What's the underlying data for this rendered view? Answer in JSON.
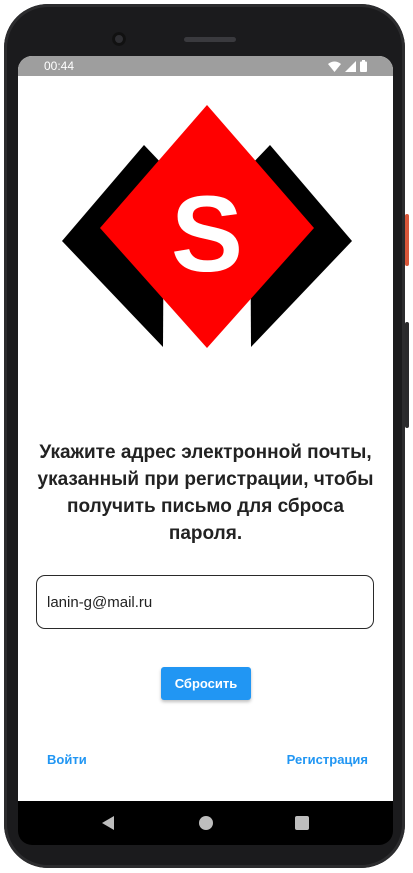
{
  "status_bar": {
    "time": "00:44",
    "icons": [
      "wifi-icon",
      "signal-icon",
      "battery-icon"
    ]
  },
  "logo": {
    "letter": "S",
    "colors": {
      "diamond": "#ff0000",
      "shadow": "#000000",
      "letter": "#ffffff"
    }
  },
  "instruction": "Укажите адрес электронной почты, указанный при регистрации, чтобы получить письмо для сброса пароля.",
  "email": {
    "value": "lanin-g@mail.ru",
    "placeholder": ""
  },
  "reset_button": {
    "label": "Сбросить"
  },
  "links": {
    "login": "Войти",
    "register": "Регистрация"
  },
  "nav_bar": {
    "buttons": [
      "back-icon",
      "home-icon",
      "recents-icon"
    ]
  },
  "colors": {
    "accent": "#2196f3",
    "status_bar": "#9e9e9e"
  }
}
